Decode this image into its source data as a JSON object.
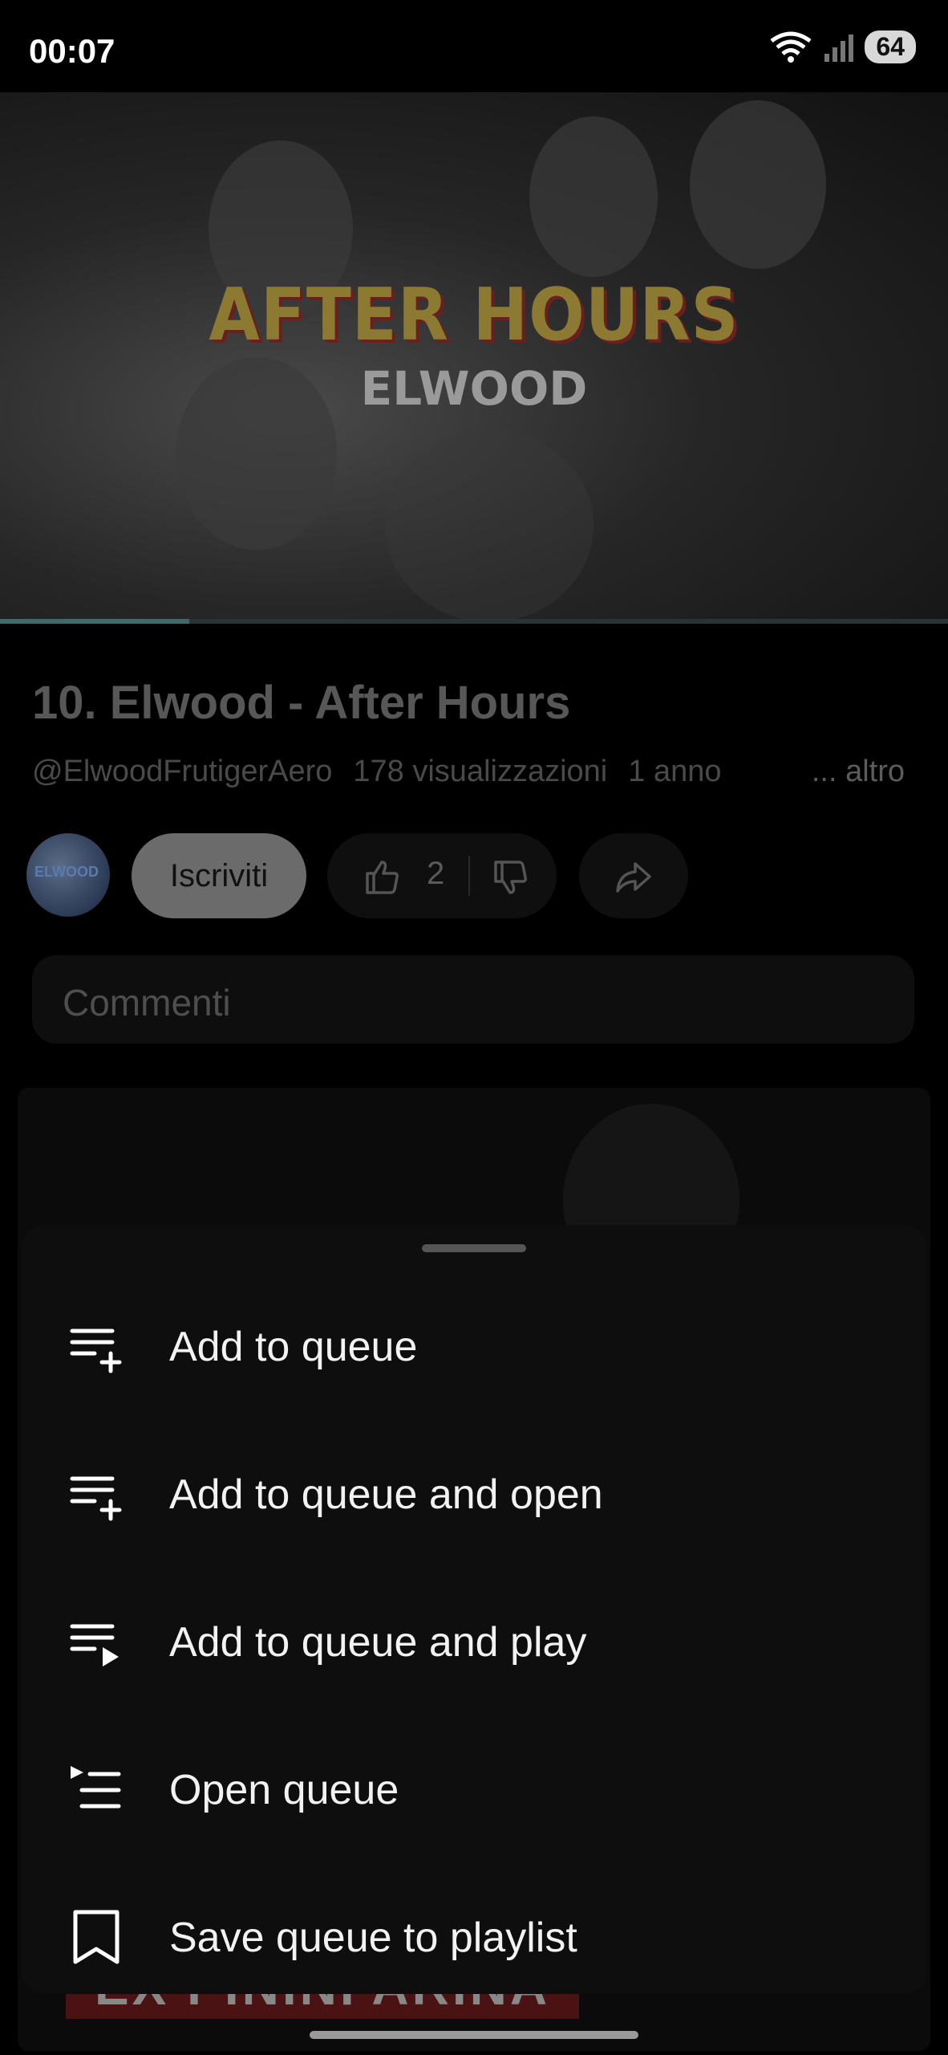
{
  "status_bar": {
    "time": "00:07",
    "battery": "64"
  },
  "video": {
    "overlay_title": "AFTER HOURS",
    "overlay_artist": "ELWOOD",
    "progress_fraction": 0.2
  },
  "video_info": {
    "title": "10. Elwood - After Hours",
    "channel_handle": "@ElwoodFrutigerAero",
    "views": "178 visualizzazioni",
    "age": "1 anno",
    "more_label": "... altro",
    "avatar_text": "ELWOOD"
  },
  "actions": {
    "subscribe_label": "Iscriviti",
    "like_count": "2"
  },
  "comments": {
    "label": "Commenti"
  },
  "background_banner": "EX PININFARINA",
  "menu": {
    "items": [
      {
        "label": "Add to queue",
        "icon": "queue-add-icon"
      },
      {
        "label": "Add to queue and open",
        "icon": "queue-add-icon"
      },
      {
        "label": "Add to queue and play",
        "icon": "queue-play-icon"
      },
      {
        "label": "Open queue",
        "icon": "open-queue-icon"
      },
      {
        "label": "Save queue to playlist",
        "icon": "bookmark-icon"
      }
    ]
  },
  "colors": {
    "accent_progress": "#3e6a67",
    "sheet_bg": "#0e0e0e"
  }
}
